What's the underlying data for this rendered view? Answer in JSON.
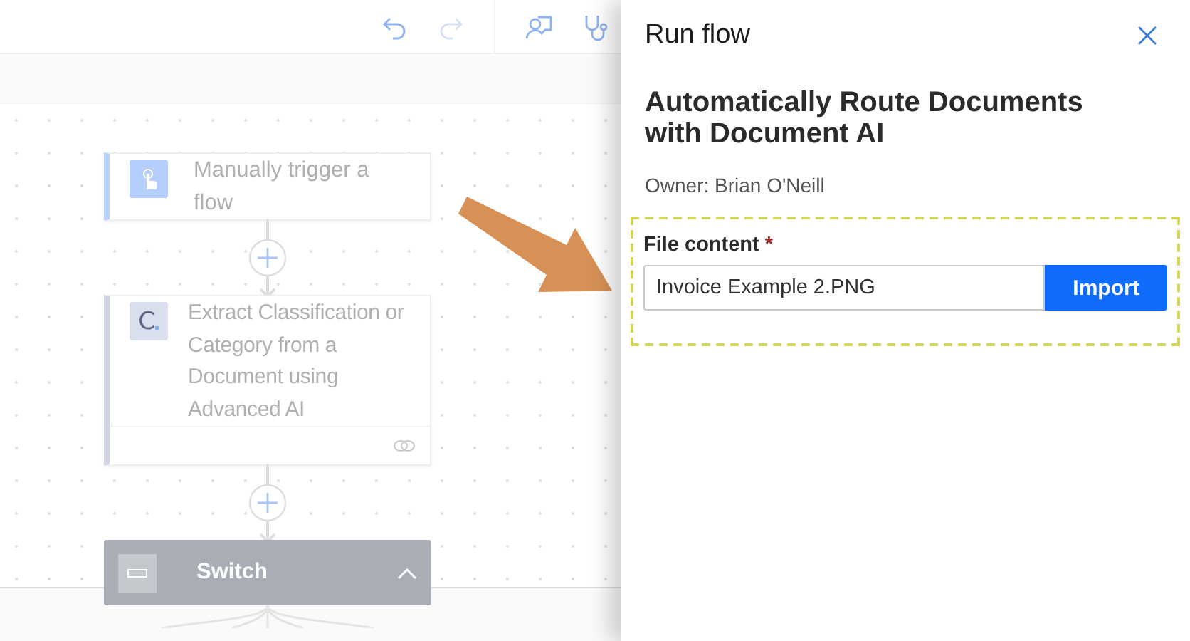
{
  "toolbar": {
    "buttons": [
      {
        "kind": "undo",
        "disabled": false
      },
      {
        "kind": "redo",
        "disabled": true
      },
      {
        "kind": "feedback",
        "disabled": false
      },
      {
        "kind": "checker",
        "disabled": false
      }
    ]
  },
  "flow": {
    "steps": [
      {
        "kind": "trigger",
        "title": "Manually trigger a flow"
      },
      {
        "kind": "action",
        "title": "Extract Classification or Category from a Document using Advanced AI",
        "icon_text": "C"
      },
      {
        "kind": "switch",
        "title": "Switch",
        "expanded": true
      }
    ]
  },
  "panel": {
    "title": "Run flow",
    "flow_name": "Automatically Route Documents with Document AI",
    "owner": "Owner: Brian O'Neill",
    "field": {
      "label": "File content",
      "required_mark": "*",
      "value": "Invoice Example 2.PNG"
    },
    "button": "Import"
  }
}
